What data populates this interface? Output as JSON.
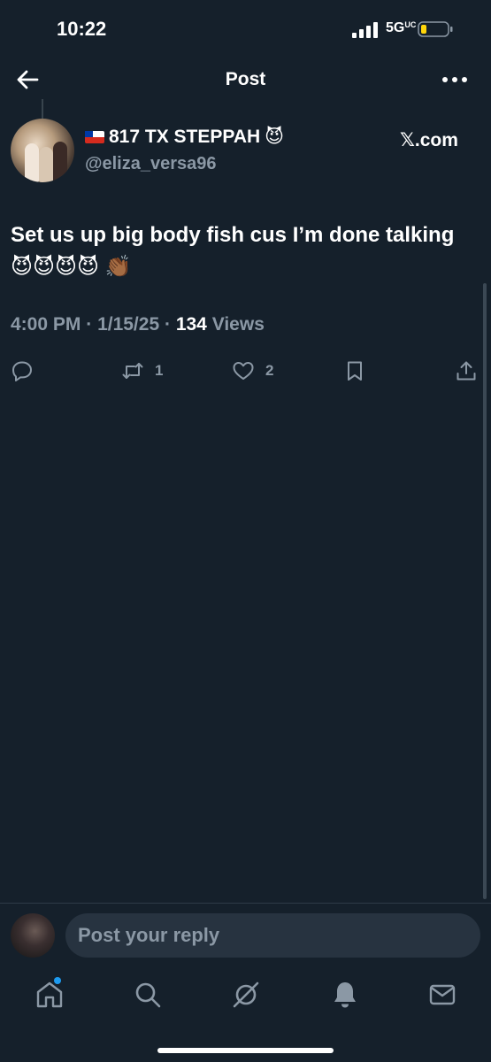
{
  "status_bar": {
    "time": "10:22",
    "network": "5G",
    "network_sub": "UC"
  },
  "nav": {
    "title": "Post",
    "back_icon": "arrow-left-icon",
    "more_icon": "more-horizontal-icon"
  },
  "author": {
    "flag_icon": "chile-flag-icon",
    "display_name": "817 TX STEPPAH",
    "name_emoji": "😈",
    "handle": "@eliza_versa96"
  },
  "source_watermark": "𝕏.com",
  "post": {
    "text": "Set us up big body fish cus I’m done talking 😈😈😈😈 👏🏾",
    "time": "4:00 PM",
    "date": "1/15/25",
    "views_count": "134",
    "views_label": "Views",
    "separator": "·"
  },
  "actions": {
    "reply_count": "",
    "repost_count": "1",
    "like_count": "2"
  },
  "reply_bar": {
    "placeholder": "Post your reply"
  },
  "tab_bar": {
    "items": [
      "home-icon",
      "search-icon",
      "grok-icon",
      "notifications-icon",
      "messages-icon"
    ]
  },
  "colors": {
    "background": "#15202b",
    "secondary_text": "#8b98a5",
    "accent": "#1d9bf0"
  }
}
